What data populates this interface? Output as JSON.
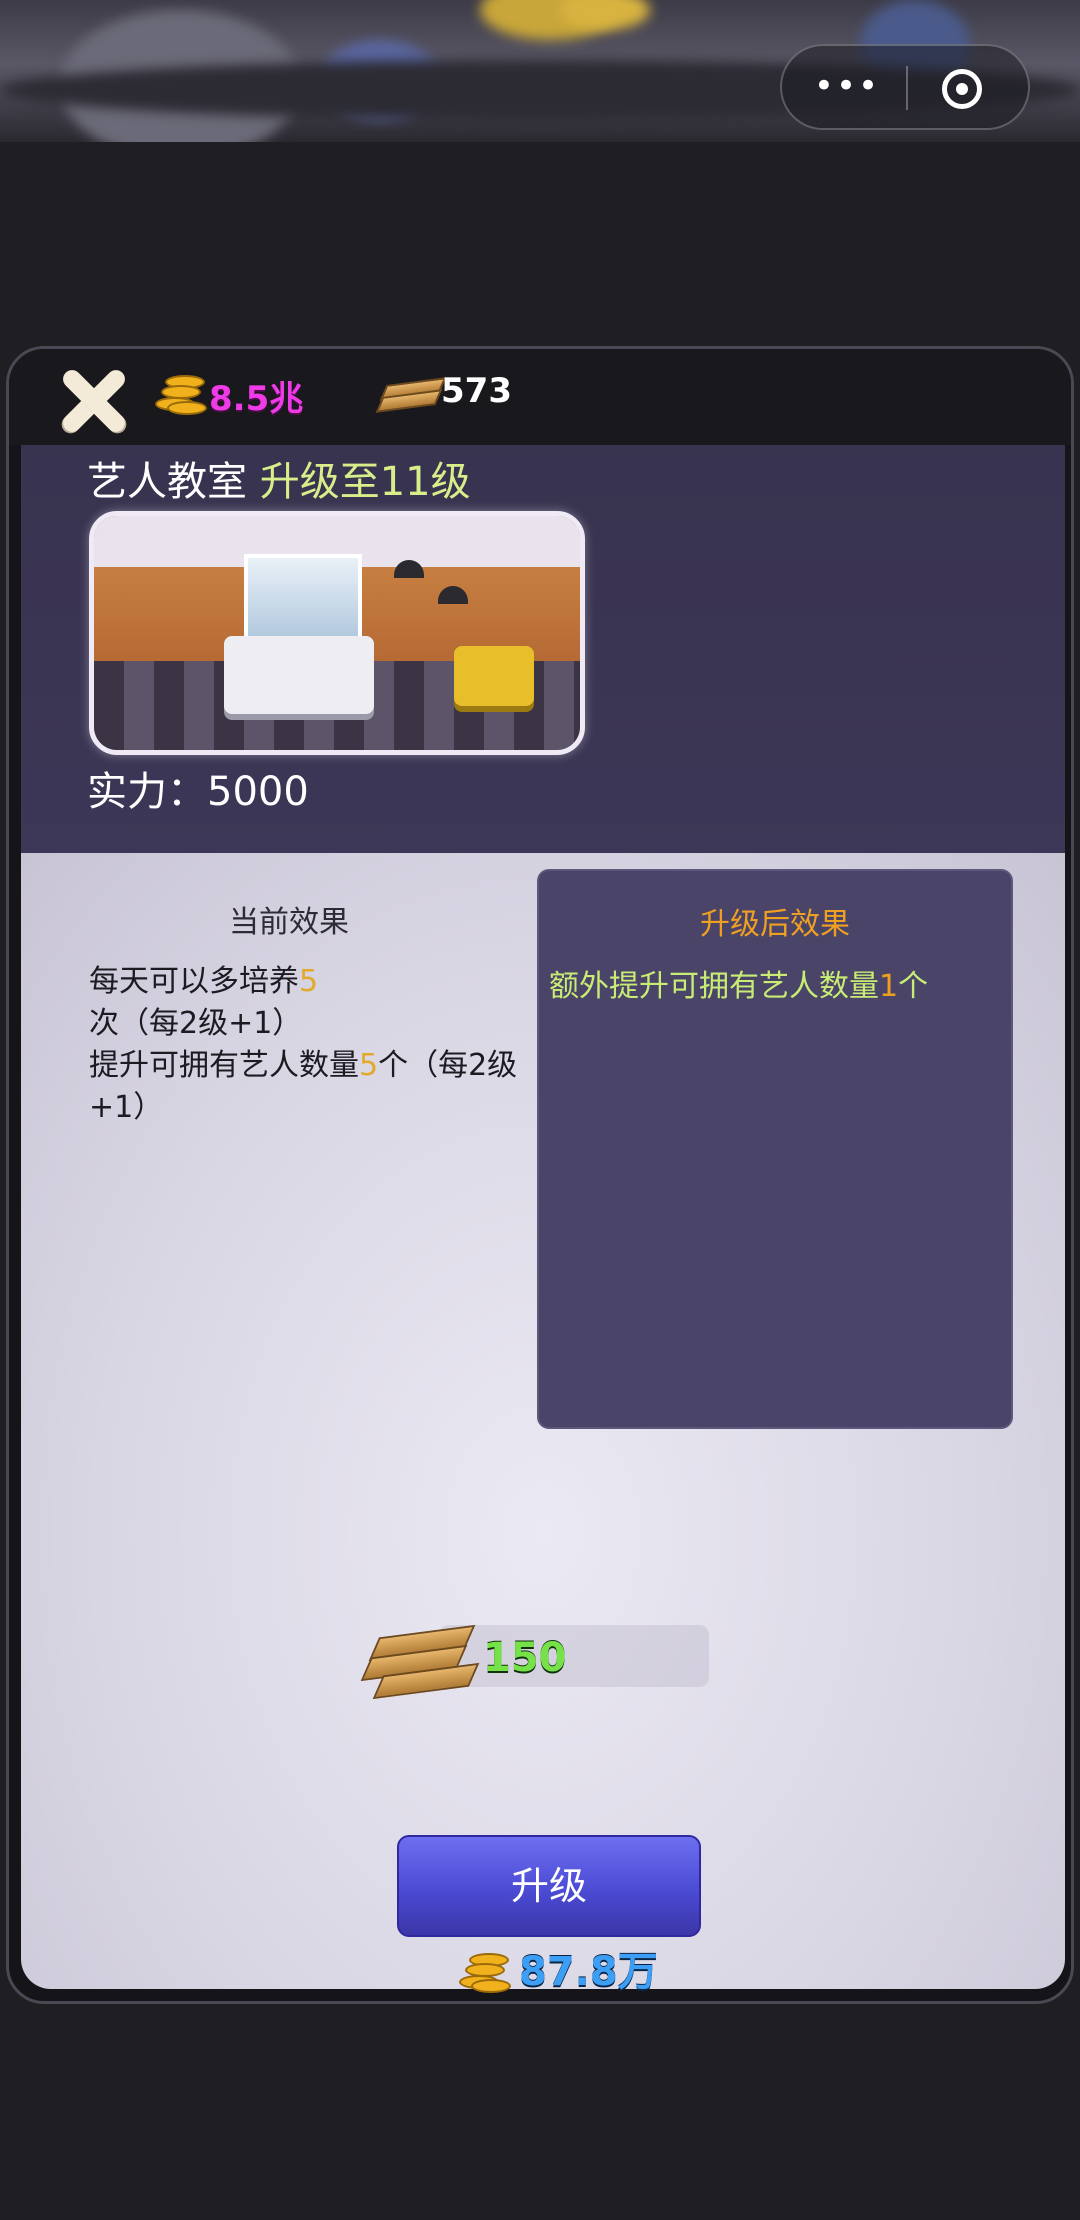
{
  "currency": {
    "gold": "8.5兆",
    "planks": "573"
  },
  "building": {
    "name": "艺人教室",
    "upgrade_label": "升级至11级",
    "power_label": "实力：",
    "power_value": "5000"
  },
  "effects": {
    "current_heading": "当前效果",
    "current_lines": [
      [
        "每天可以多培养",
        "5",
        "次（每2级+1）"
      ],
      [
        "提升可拥有艺人数量",
        "5",
        "个（每2级+1）"
      ]
    ],
    "next_heading": "升级后效果",
    "next_line": [
      "额外提升可拥有艺人数量",
      "1",
      "个"
    ]
  },
  "cost": {
    "planks": "150"
  },
  "upgrade_button": {
    "label": "升级",
    "gold_cost": "87.8万"
  },
  "colors": {
    "gold_text": "#ef3ae8",
    "highlight_green": "#d7ee8a",
    "orange": "#f0a020",
    "cost_green": "#76e24a",
    "price_blue": "#3c9ef5",
    "button": "#4b4bd4"
  }
}
